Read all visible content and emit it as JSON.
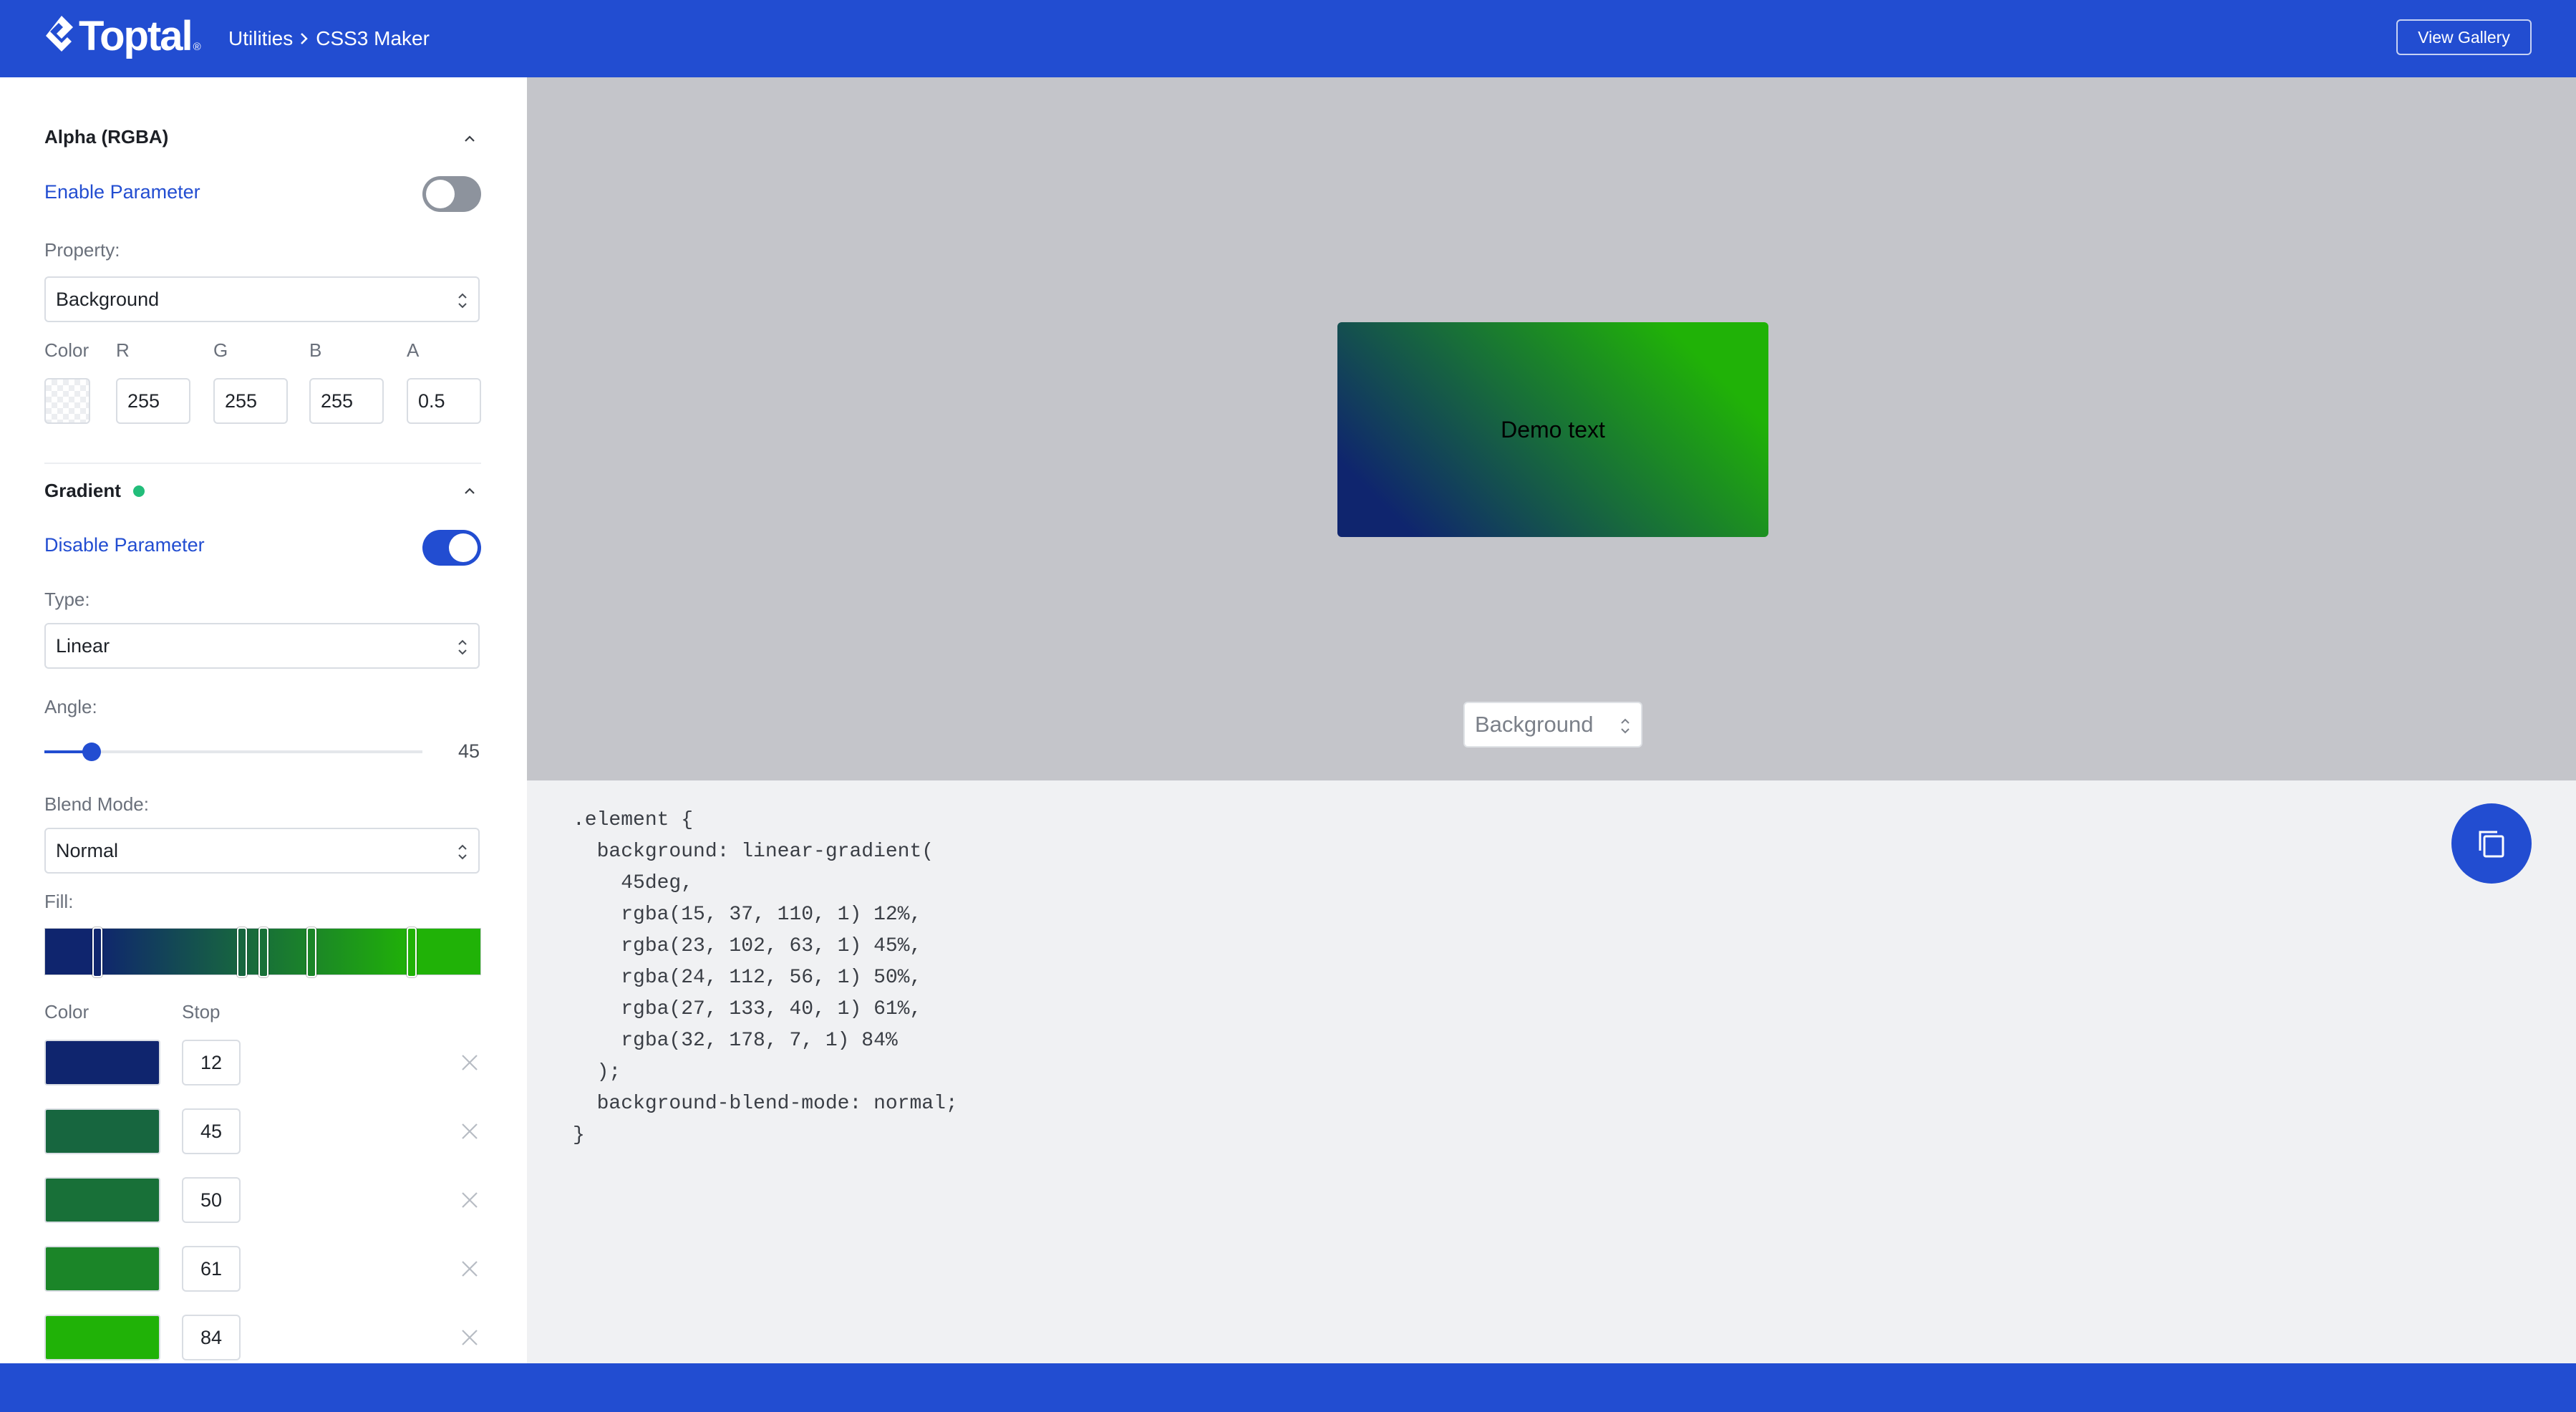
{
  "header": {
    "logo_text": "Toptal",
    "logo_reg": "®",
    "breadcrumb": [
      "Utilities",
      "CSS3 Maker"
    ],
    "view_gallery_label": "View Gallery"
  },
  "alpha": {
    "title": "Alpha (RGBA)",
    "toggle_label": "Enable Parameter",
    "enabled": false,
    "property_label": "Property:",
    "property_value": "Background",
    "color_label": "Color",
    "r_label": "R",
    "g_label": "G",
    "b_label": "B",
    "a_label": "A",
    "r": "255",
    "g": "255",
    "b": "255",
    "a": "0.5"
  },
  "gradient": {
    "title": "Gradient",
    "toggle_label": "Disable Parameter",
    "enabled": true,
    "type_label": "Type:",
    "type_value": "Linear",
    "angle_label": "Angle:",
    "angle_value": "45",
    "angle_fraction": 0.125,
    "blend_label": "Blend Mode:",
    "blend_value": "Normal",
    "fill_label": "Fill:",
    "color_col": "Color",
    "stop_col": "Stop",
    "stops": [
      {
        "color": "#0f256e",
        "stop": "12"
      },
      {
        "color": "#17663f",
        "stop": "45"
      },
      {
        "color": "#187038",
        "stop": "50"
      },
      {
        "color": "#1b8528",
        "stop": "61"
      },
      {
        "color": "#20b207",
        "stop": "84"
      }
    ]
  },
  "preview": {
    "demo_text": "Demo text",
    "select_value": "Background"
  },
  "code": {
    "lines": [
      ".element {",
      "  background: linear-gradient(",
      "    45deg,",
      "    rgba(15, 37, 110, 1) 12%,",
      "    rgba(23, 102, 63, 1) 45%,",
      "    rgba(24, 112, 56, 1) 50%,",
      "    rgba(27, 133, 40, 1) 61%,",
      "    rgba(32, 178, 7, 1) 84%",
      "  );",
      "  background-blend-mode: normal;",
      "}"
    ]
  },
  "colors": {
    "brand": "#224dd1",
    "dot": "#22bd7a"
  }
}
